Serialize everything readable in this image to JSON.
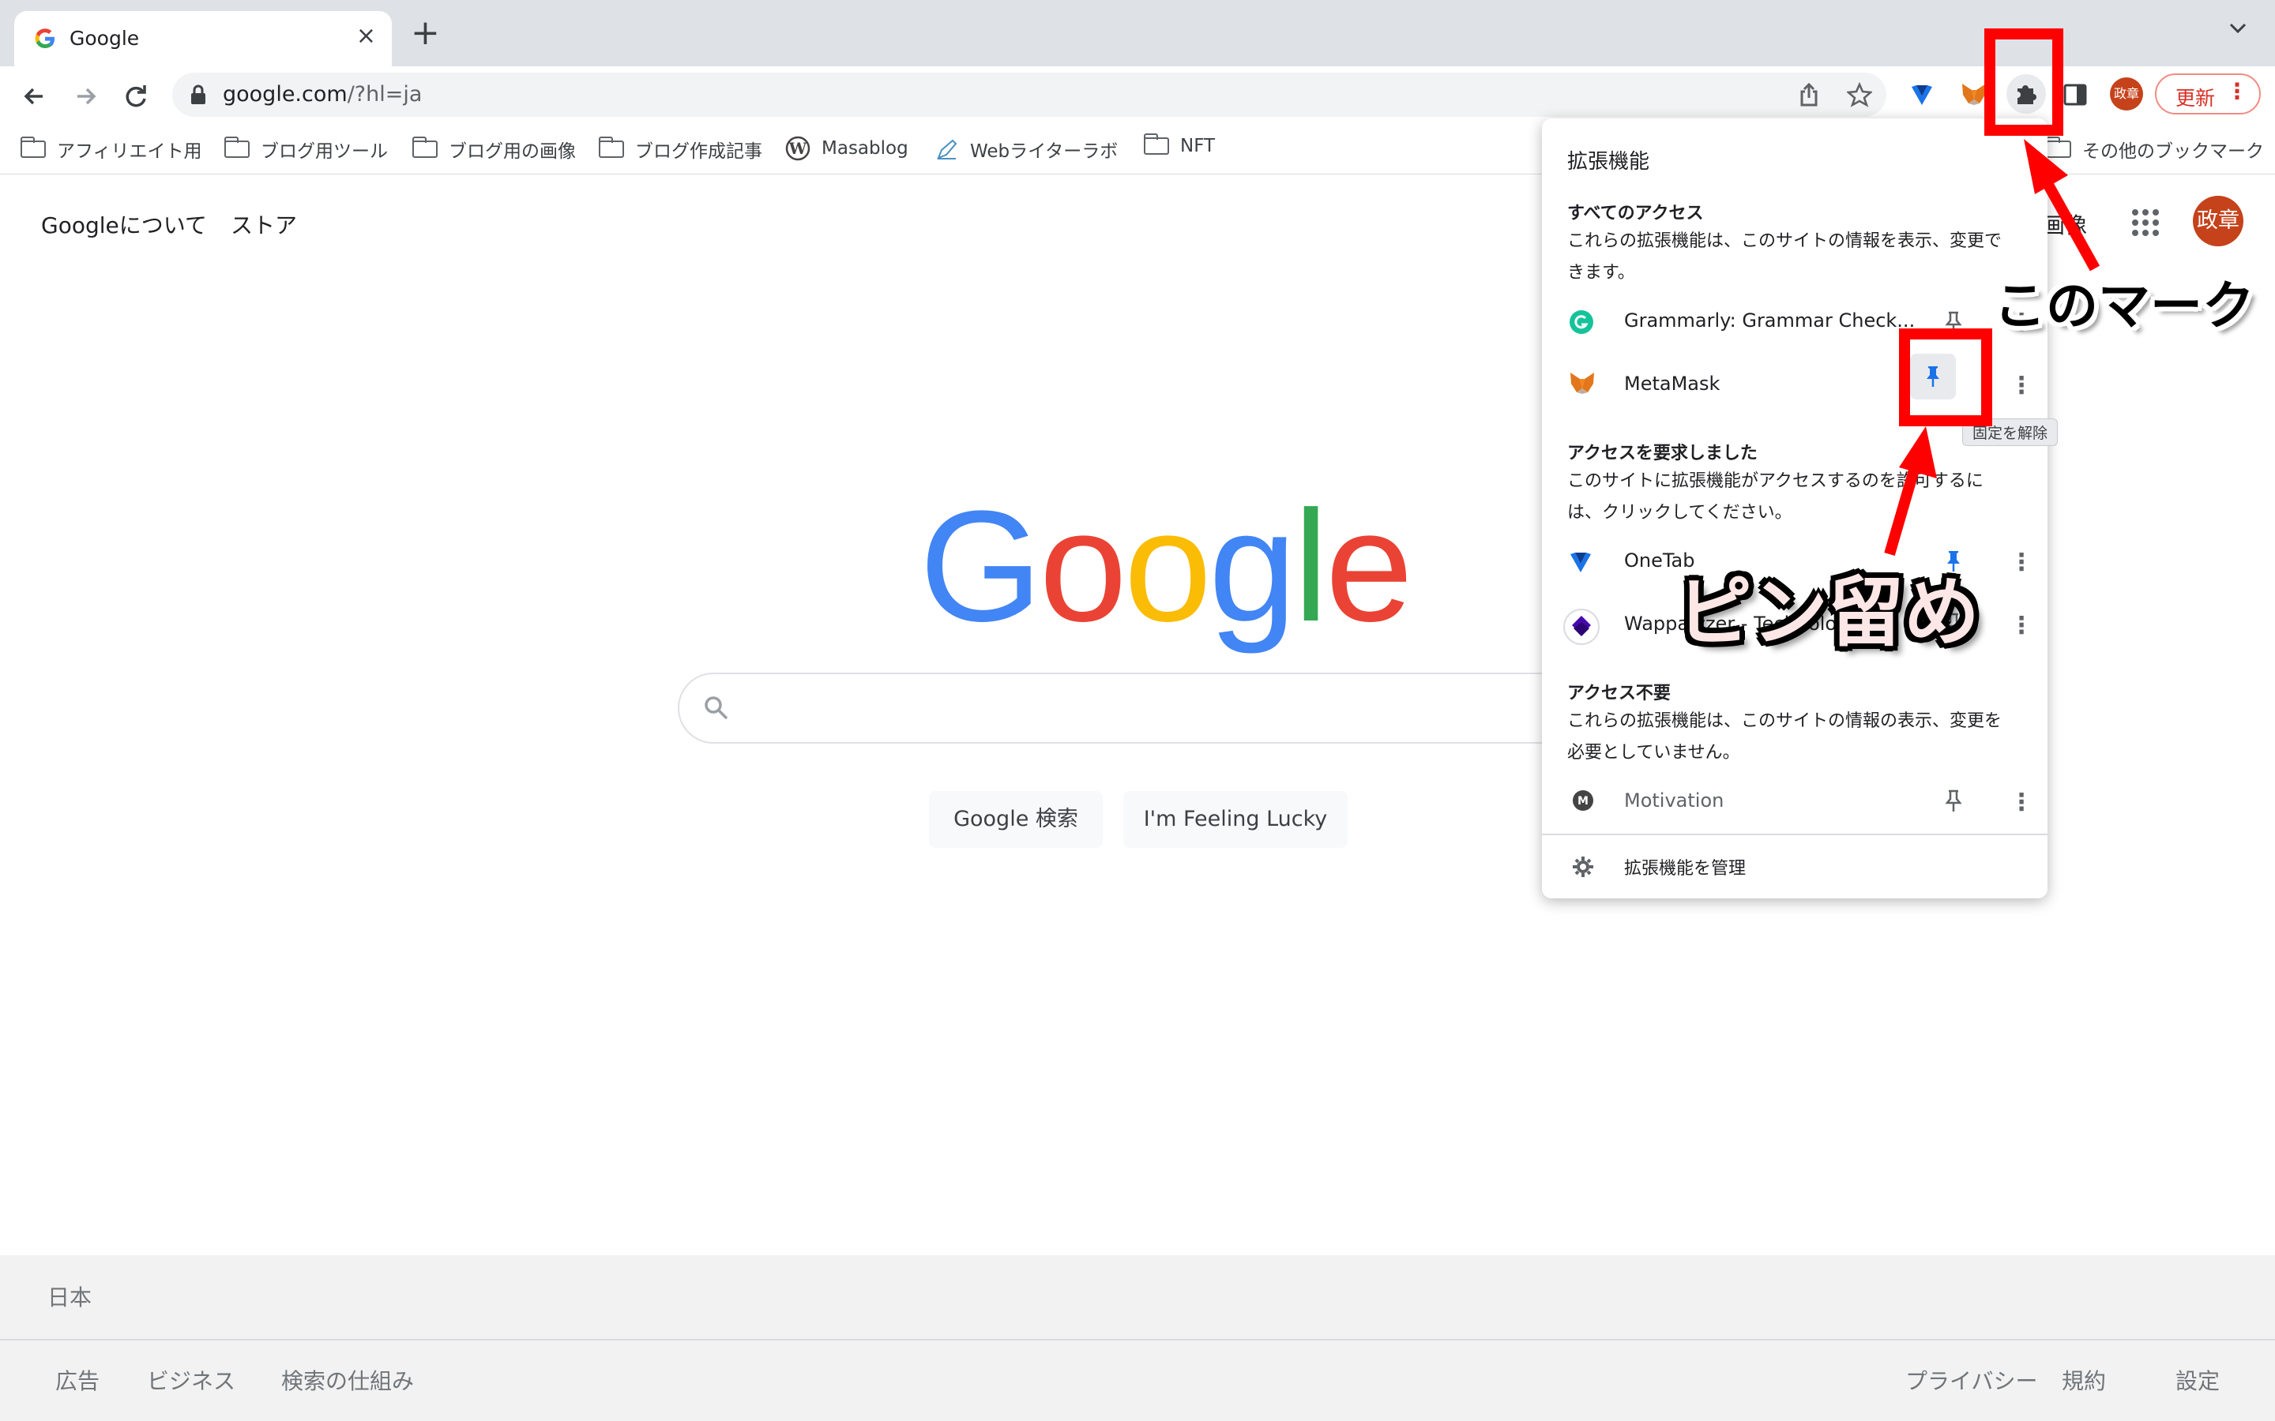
{
  "browser": {
    "tab_title": "Google",
    "new_tab_symbol": "+",
    "close_symbol": "×",
    "url_host": "google.com",
    "url_path": "/?hl=ja",
    "update_label": "更新",
    "profile_initials": "政章"
  },
  "bookmarks": {
    "items": [
      {
        "label": "アフィリエイト用",
        "icon": "folder-icon"
      },
      {
        "label": "ブログ用ツール",
        "icon": "folder-icon"
      },
      {
        "label": "ブログ用の画像",
        "icon": "folder-icon"
      },
      {
        "label": "ブログ作成記事",
        "icon": "folder-icon"
      },
      {
        "label": "Masablog",
        "icon": "wordpress-icon"
      },
      {
        "label": "Webライターラボ",
        "icon": "pen-icon"
      },
      {
        "label": "NFT",
        "icon": "folder-icon"
      }
    ],
    "other_label": "その他のブックマーク"
  },
  "page": {
    "about_label": "Googleについて",
    "store_label": "ストア",
    "images_label": "画像",
    "avatar_label": "政章",
    "logo_letters": [
      "G",
      "o",
      "o",
      "g",
      "l",
      "e"
    ],
    "logo_colors": [
      "#4285f4",
      "#ea4335",
      "#fbbc05",
      "#4285f4",
      "#34a853",
      "#ea4335"
    ],
    "search_button": "Google 検索",
    "lucky_button": "I'm Feeling Lucky"
  },
  "footer": {
    "country": "日本",
    "left_links": [
      "広告",
      "ビジネス",
      "検索の仕組み"
    ],
    "right_links": [
      "プライバシー",
      "規約",
      "設定"
    ]
  },
  "extensions_popup": {
    "title": "拡張機能",
    "section_full": {
      "heading": "すべてのアクセス",
      "description": "これらの拡張機能は、このサイトの情報を表示、変更できます。",
      "items": [
        {
          "name": "Grammarly: Grammar Check...",
          "icon": "grammarly-icon",
          "pinned": false
        },
        {
          "name": "MetaMask",
          "icon": "metamask-icon",
          "pinned": true
        }
      ]
    },
    "tooltip": "固定を解除",
    "section_requested": {
      "heading": "アクセスを要求しました",
      "description": "このサイトに拡張機能がアクセスするのを許可するには、クリックしてください。",
      "items": [
        {
          "name": "OneTab",
          "icon": "onetab-icon",
          "pinned": true
        },
        {
          "name": "Wappalyzer - Technology profiler",
          "icon": "wappalyzer-icon",
          "pinned": false
        }
      ]
    },
    "section_none": {
      "heading": "アクセス不要",
      "description": "これらの拡張機能は、このサイトの情報の表示、変更を必要としていません。",
      "items": [
        {
          "name": "Motivation",
          "icon": "motivation-icon",
          "pinned": false
        }
      ]
    },
    "manage_label": "拡張機能を管理"
  },
  "annotations": {
    "extension_mark_label": "このマーク",
    "pin_label": "ピン留め",
    "color": "#ff0000"
  }
}
